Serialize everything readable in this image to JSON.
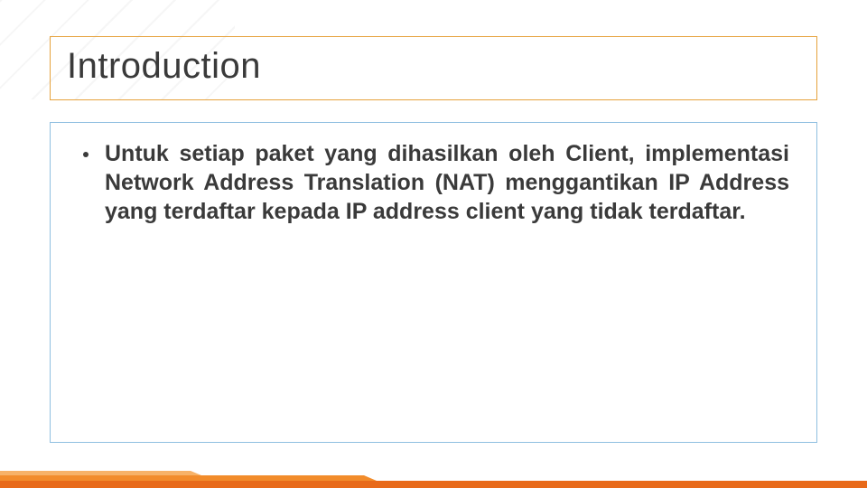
{
  "slide": {
    "title": "Introduction",
    "bullets": [
      "Untuk setiap paket yang dihasilkan oleh Client, implementasi Network Address Translation (NAT) menggantikan IP Address yang terdaftar kepada IP address client yang tidak terdaftar."
    ]
  }
}
